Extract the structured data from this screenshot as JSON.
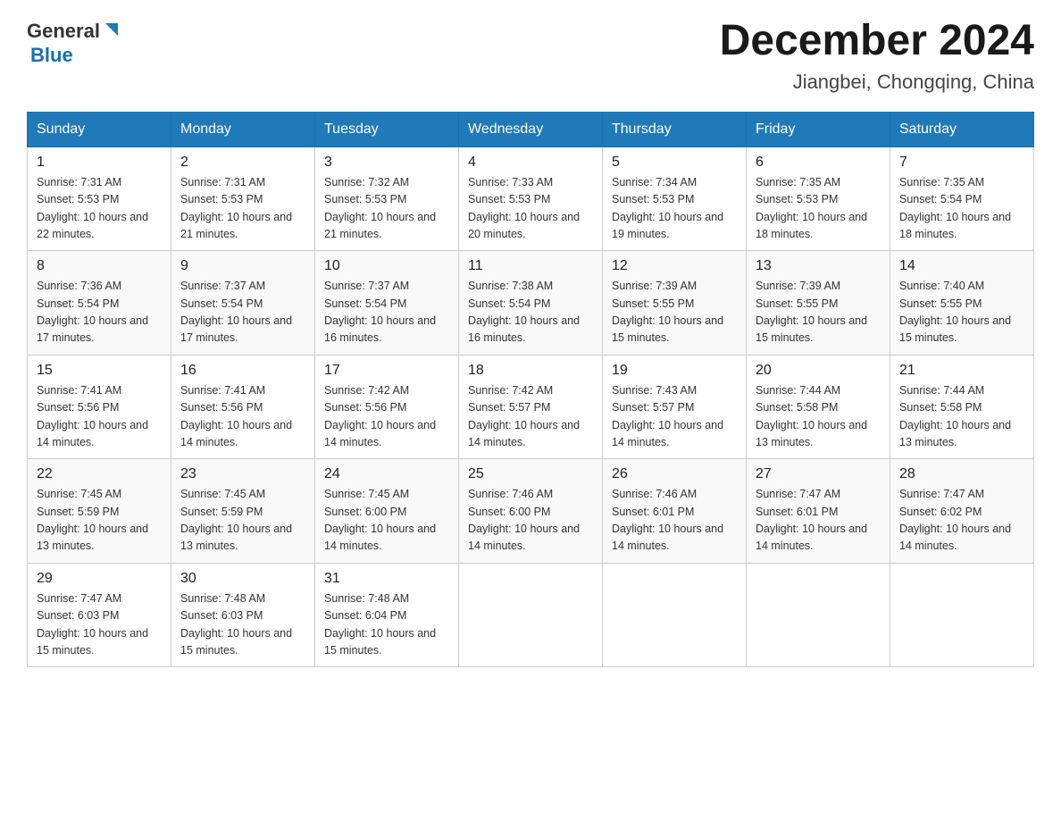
{
  "logo": {
    "general": "General",
    "blue": "Blue"
  },
  "title": {
    "month_year": "December 2024",
    "location": "Jiangbei, Chongqing, China"
  },
  "weekdays": [
    "Sunday",
    "Monday",
    "Tuesday",
    "Wednesday",
    "Thursday",
    "Friday",
    "Saturday"
  ],
  "weeks": [
    [
      {
        "day": "1",
        "sunrise": "7:31 AM",
        "sunset": "5:53 PM",
        "daylight": "10 hours and 22 minutes."
      },
      {
        "day": "2",
        "sunrise": "7:31 AM",
        "sunset": "5:53 PM",
        "daylight": "10 hours and 21 minutes."
      },
      {
        "day": "3",
        "sunrise": "7:32 AM",
        "sunset": "5:53 PM",
        "daylight": "10 hours and 21 minutes."
      },
      {
        "day": "4",
        "sunrise": "7:33 AM",
        "sunset": "5:53 PM",
        "daylight": "10 hours and 20 minutes."
      },
      {
        "day": "5",
        "sunrise": "7:34 AM",
        "sunset": "5:53 PM",
        "daylight": "10 hours and 19 minutes."
      },
      {
        "day": "6",
        "sunrise": "7:35 AM",
        "sunset": "5:53 PM",
        "daylight": "10 hours and 18 minutes."
      },
      {
        "day": "7",
        "sunrise": "7:35 AM",
        "sunset": "5:54 PM",
        "daylight": "10 hours and 18 minutes."
      }
    ],
    [
      {
        "day": "8",
        "sunrise": "7:36 AM",
        "sunset": "5:54 PM",
        "daylight": "10 hours and 17 minutes."
      },
      {
        "day": "9",
        "sunrise": "7:37 AM",
        "sunset": "5:54 PM",
        "daylight": "10 hours and 17 minutes."
      },
      {
        "day": "10",
        "sunrise": "7:37 AM",
        "sunset": "5:54 PM",
        "daylight": "10 hours and 16 minutes."
      },
      {
        "day": "11",
        "sunrise": "7:38 AM",
        "sunset": "5:54 PM",
        "daylight": "10 hours and 16 minutes."
      },
      {
        "day": "12",
        "sunrise": "7:39 AM",
        "sunset": "5:55 PM",
        "daylight": "10 hours and 15 minutes."
      },
      {
        "day": "13",
        "sunrise": "7:39 AM",
        "sunset": "5:55 PM",
        "daylight": "10 hours and 15 minutes."
      },
      {
        "day": "14",
        "sunrise": "7:40 AM",
        "sunset": "5:55 PM",
        "daylight": "10 hours and 15 minutes."
      }
    ],
    [
      {
        "day": "15",
        "sunrise": "7:41 AM",
        "sunset": "5:56 PM",
        "daylight": "10 hours and 14 minutes."
      },
      {
        "day": "16",
        "sunrise": "7:41 AM",
        "sunset": "5:56 PM",
        "daylight": "10 hours and 14 minutes."
      },
      {
        "day": "17",
        "sunrise": "7:42 AM",
        "sunset": "5:56 PM",
        "daylight": "10 hours and 14 minutes."
      },
      {
        "day": "18",
        "sunrise": "7:42 AM",
        "sunset": "5:57 PM",
        "daylight": "10 hours and 14 minutes."
      },
      {
        "day": "19",
        "sunrise": "7:43 AM",
        "sunset": "5:57 PM",
        "daylight": "10 hours and 14 minutes."
      },
      {
        "day": "20",
        "sunrise": "7:44 AM",
        "sunset": "5:58 PM",
        "daylight": "10 hours and 13 minutes."
      },
      {
        "day": "21",
        "sunrise": "7:44 AM",
        "sunset": "5:58 PM",
        "daylight": "10 hours and 13 minutes."
      }
    ],
    [
      {
        "day": "22",
        "sunrise": "7:45 AM",
        "sunset": "5:59 PM",
        "daylight": "10 hours and 13 minutes."
      },
      {
        "day": "23",
        "sunrise": "7:45 AM",
        "sunset": "5:59 PM",
        "daylight": "10 hours and 13 minutes."
      },
      {
        "day": "24",
        "sunrise": "7:45 AM",
        "sunset": "6:00 PM",
        "daylight": "10 hours and 14 minutes."
      },
      {
        "day": "25",
        "sunrise": "7:46 AM",
        "sunset": "6:00 PM",
        "daylight": "10 hours and 14 minutes."
      },
      {
        "day": "26",
        "sunrise": "7:46 AM",
        "sunset": "6:01 PM",
        "daylight": "10 hours and 14 minutes."
      },
      {
        "day": "27",
        "sunrise": "7:47 AM",
        "sunset": "6:01 PM",
        "daylight": "10 hours and 14 minutes."
      },
      {
        "day": "28",
        "sunrise": "7:47 AM",
        "sunset": "6:02 PM",
        "daylight": "10 hours and 14 minutes."
      }
    ],
    [
      {
        "day": "29",
        "sunrise": "7:47 AM",
        "sunset": "6:03 PM",
        "daylight": "10 hours and 15 minutes."
      },
      {
        "day": "30",
        "sunrise": "7:48 AM",
        "sunset": "6:03 PM",
        "daylight": "10 hours and 15 minutes."
      },
      {
        "day": "31",
        "sunrise": "7:48 AM",
        "sunset": "6:04 PM",
        "daylight": "10 hours and 15 minutes."
      },
      null,
      null,
      null,
      null
    ]
  ]
}
